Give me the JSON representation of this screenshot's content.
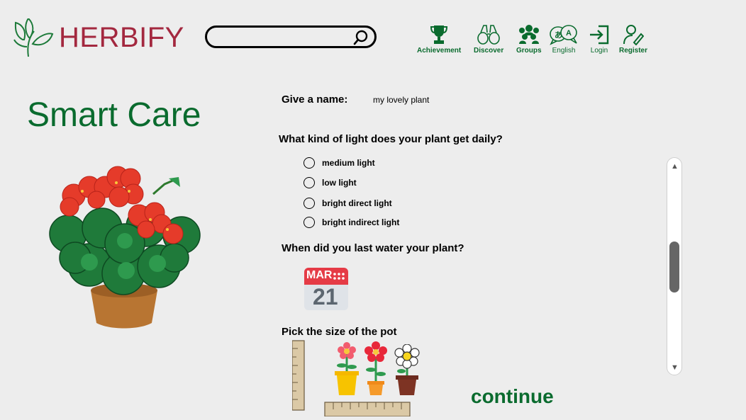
{
  "brand": {
    "name": "HERBIFY"
  },
  "search": {
    "placeholder": ""
  },
  "nav": {
    "achievement": "Achievement",
    "discover": "Discover",
    "groups": "Groups",
    "language": "English",
    "login": "Login",
    "register": "Register"
  },
  "page": {
    "title": "Smart Care"
  },
  "form": {
    "name_label": "Give a name:",
    "name_value": "my lovely plant",
    "light_question": "What kind of light does your plant get daily?",
    "light_options": [
      "medium light",
      "low light",
      "bright direct light",
      "bright indirect light"
    ],
    "water_question": "When did you last water your plant?",
    "calendar": {
      "month": "MAR",
      "day": "21"
    },
    "pot_question": "Pick the size of the pot",
    "continue_label": "continue"
  },
  "colors": {
    "brand": "#a3283f",
    "accent_green": "#0a6b2e",
    "background": "#ededed"
  }
}
